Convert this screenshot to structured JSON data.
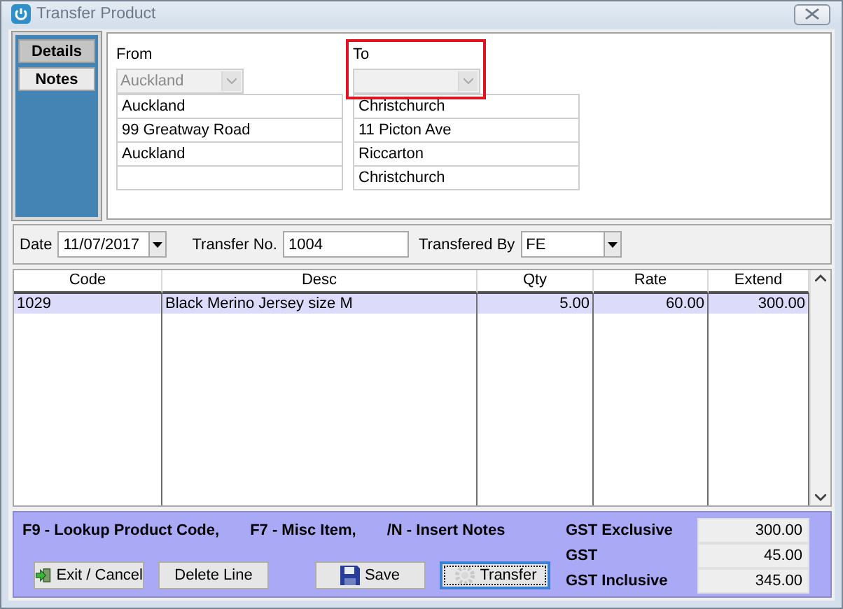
{
  "window": {
    "title": "Transfer Product"
  },
  "side_tabs": [
    {
      "label": "Details",
      "selected": true
    },
    {
      "label": "Notes",
      "selected": false
    }
  ],
  "addresses": [
    {
      "label": "From",
      "highlighted": false,
      "dropdown": {
        "value": "Auckland",
        "disabled": true
      },
      "lines": [
        "Auckland",
        "99 Greatway Road",
        "Auckland"
      ]
    },
    {
      "label": "To",
      "highlighted": true,
      "dropdown": {
        "disabled": true
      },
      "lines": [
        "Christchurch",
        "11 Picton Ave",
        "Riccarton",
        "Christchurch"
      ]
    }
  ],
  "details": [
    {
      "label": "Date",
      "value": "11/07/2017",
      "kind": "dropdown"
    },
    {
      "label": "Transfer No.",
      "value": "1004",
      "kind": "text"
    },
    {
      "label": "Transfered By",
      "value": "FE",
      "kind": "dropdown"
    }
  ],
  "table": {
    "columns": [
      {
        "label": "Code",
        "kind": "text"
      },
      {
        "label": "Desc",
        "kind": "text"
      },
      {
        "label": "Qty",
        "kind": "number"
      },
      {
        "label": "Rate",
        "kind": "number"
      },
      {
        "label": "Extend",
        "kind": "number"
      }
    ],
    "rows": [
      {
        "cells": [
          "1029",
          "Black Merino Jersey size M",
          "5.00",
          "60.00",
          "300.00"
        ],
        "selected": true
      }
    ]
  },
  "footer": {
    "hints": [
      "F9 - Lookup Product Code,",
      "F7 - Misc Item,",
      "/N - Insert Notes"
    ],
    "buttons": [
      {
        "label": "Exit / Cancel",
        "kind": "exit",
        "focused": false
      },
      {
        "label": "Delete Line",
        "kind": "plain",
        "focused": false
      },
      {
        "label": "Save",
        "kind": "save",
        "focused": false
      },
      {
        "label": "Transfer",
        "kind": "transfer",
        "focused": true
      }
    ],
    "totals": [
      {
        "label": "GST Exclusive",
        "value": "300.00"
      },
      {
        "label": "GST",
        "value": "45.00"
      },
      {
        "label": "GST Inclusive",
        "value": "345.00"
      }
    ]
  }
}
